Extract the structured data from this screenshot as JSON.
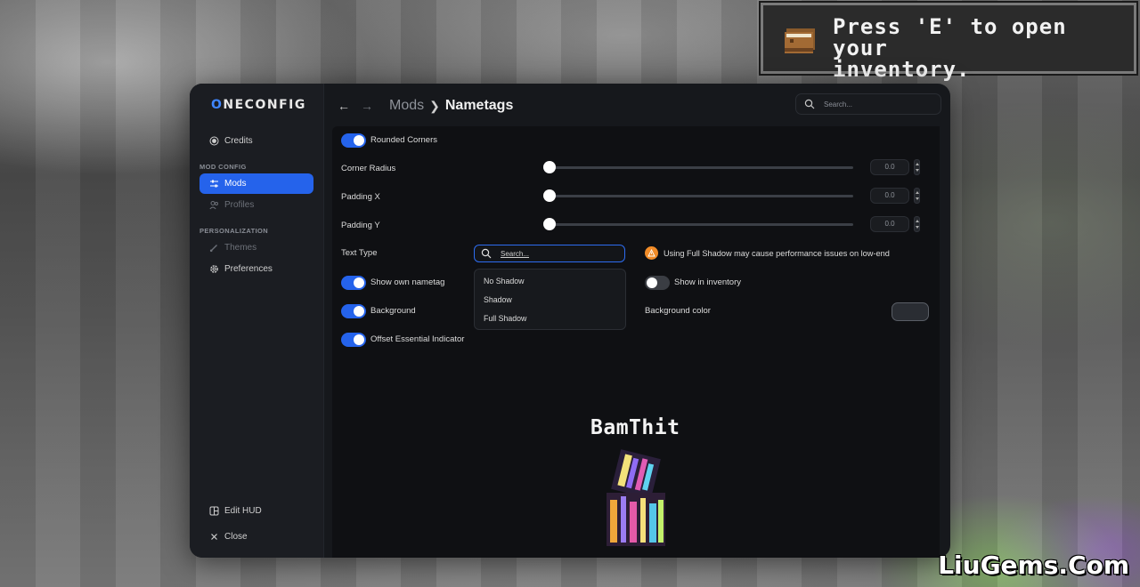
{
  "toast": {
    "message_line1": "Press 'E' to open your",
    "message_line2": "inventory."
  },
  "watermark": "LiuGems.Com",
  "app": {
    "logo_prefix": "O",
    "logo_rest": "NECONFIG"
  },
  "sidebar": {
    "credits": "Credits",
    "section_mod_config": "MOD CONFIG",
    "mods": "Mods",
    "profiles": "Profiles",
    "section_personalization": "PERSONALIZATION",
    "themes": "Themes",
    "preferences": "Preferences",
    "edit_hud": "Edit HUD",
    "close": "Close"
  },
  "header": {
    "crumb_parent": "Mods",
    "crumb_current": "Nametags",
    "search_placeholder": "Search..."
  },
  "settings": {
    "rounded_corners": {
      "label": "Rounded Corners",
      "on": true
    },
    "corner_radius": {
      "label": "Corner Radius",
      "value": "0.0"
    },
    "padding_x": {
      "label": "Padding X",
      "value": "0.0"
    },
    "padding_y": {
      "label": "Padding Y",
      "value": "0.0"
    },
    "text_type": {
      "label": "Text Type",
      "search_placeholder": "Search...",
      "options": [
        "No Shadow",
        "Shadow",
        "Full Shadow"
      ]
    },
    "warning": "Using Full Shadow may cause performance issues on low-end",
    "show_own_nametag": {
      "label": "Show own nametag",
      "on": true
    },
    "show_in_inventory": {
      "label": "Show in inventory",
      "on": false
    },
    "background": {
      "label": "Background",
      "on": true
    },
    "background_color": {
      "label": "Background color"
    },
    "offset_essential": {
      "label": "Offset Essential Indicator",
      "on": true
    }
  },
  "preview": {
    "player_name": "BamThit"
  },
  "colors": {
    "accent": "#2563eb",
    "warning": "#f28c28"
  }
}
